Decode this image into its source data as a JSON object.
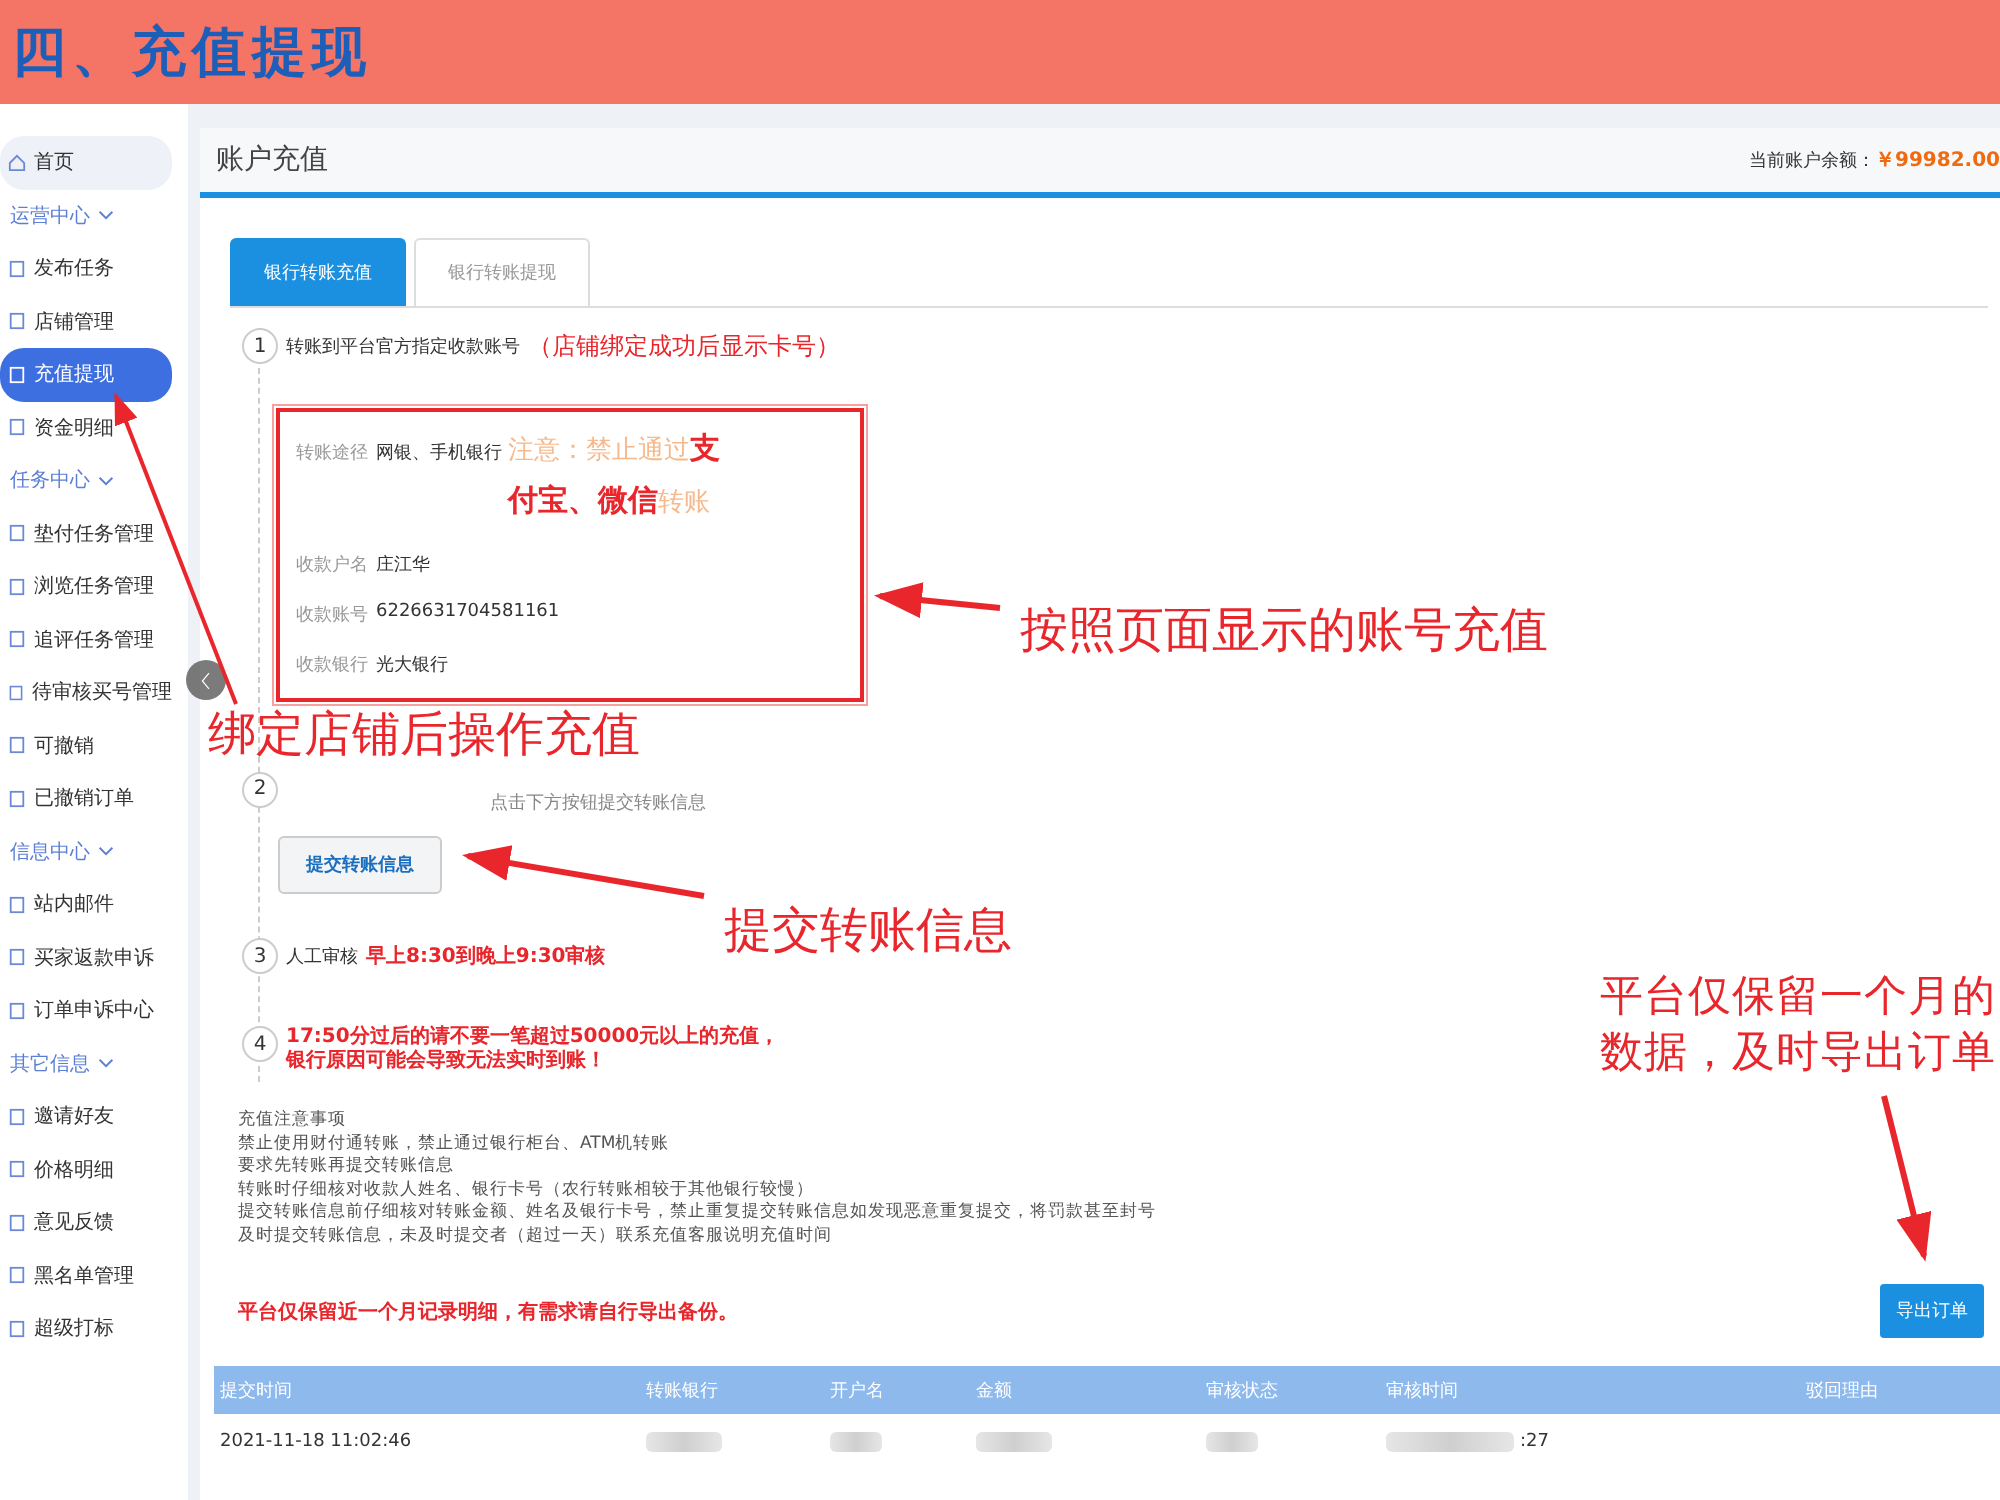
{
  "slide_title": "四、充值提现",
  "sidebar": [
    {
      "kind": "home",
      "label": "首页",
      "selected": false
    },
    {
      "kind": "group",
      "label": "运营中心"
    },
    {
      "kind": "item",
      "label": "发布任务",
      "selected": false
    },
    {
      "kind": "item",
      "label": "店铺管理",
      "selected": false
    },
    {
      "kind": "item",
      "label": "充值提现",
      "selected": true
    },
    {
      "kind": "item",
      "label": "资金明细",
      "selected": false
    },
    {
      "kind": "group",
      "label": "任务中心"
    },
    {
      "kind": "item",
      "label": "垫付任务管理",
      "selected": false
    },
    {
      "kind": "item",
      "label": "浏览任务管理",
      "selected": false
    },
    {
      "kind": "item",
      "label": "追评任务管理",
      "selected": false
    },
    {
      "kind": "item",
      "label": "待审核买号管理",
      "selected": false
    },
    {
      "kind": "item",
      "label": "可撤销",
      "selected": false
    },
    {
      "kind": "item",
      "label": "已撤销订单",
      "selected": false
    },
    {
      "kind": "group",
      "label": "信息中心"
    },
    {
      "kind": "item",
      "label": "站内邮件",
      "selected": false
    },
    {
      "kind": "item",
      "label": "买家返款申诉",
      "selected": false
    },
    {
      "kind": "item",
      "label": "订单申诉中心",
      "selected": false
    },
    {
      "kind": "group",
      "label": "其它信息"
    },
    {
      "kind": "item",
      "label": "邀请好友",
      "selected": false
    },
    {
      "kind": "item",
      "label": "价格明细",
      "selected": false
    },
    {
      "kind": "item",
      "label": "意见反馈",
      "selected": false
    },
    {
      "kind": "item",
      "label": "黑名单管理",
      "selected": false
    },
    {
      "kind": "item",
      "label": "超级打标",
      "selected": false
    }
  ],
  "page_title": "账户充值",
  "balance": {
    "label": "当前账户余额：",
    "value": "￥99982.00"
  },
  "tabs": [
    {
      "label": "银行转账充值",
      "selected": true
    },
    {
      "label": "银行转账提现",
      "selected": false
    }
  ],
  "step1": {
    "number": "1",
    "text": "转账到平台官方指定收款账号",
    "note": "（店铺绑定成功后显示卡号）"
  },
  "account": [
    {
      "label": "转账途径",
      "value": "网银、手机银行",
      "warning": "注意：禁止通过**支付宝、微信**转账"
    },
    {
      "label": "收款户名",
      "value": "庄江华"
    },
    {
      "label": "收款账号",
      "value": "6226631704581161"
    },
    {
      "label": "收款银行",
      "value": "光大银行"
    }
  ],
  "step2": {
    "number": "2",
    "text": "点击下方按钮提交转账信息",
    "button": "提交转账信息"
  },
  "step3": {
    "number": "3",
    "text": "人工审核",
    "highlight": "早上8:30到晚上9:30审核"
  },
  "step4": {
    "number": "4",
    "text": "17:50分过后的请不要一笔超过50000元以上的充值，银行原因可能会导致无法实时到账！"
  },
  "notes": [
    "充值注意事项",
    "禁止使用财付通转账，禁止通过银行柜台、ATM机转账",
    "要求先转账再提交转账信息",
    "转账时仔细核对收款人姓名、银行卡号（农行转账相较于其他银行较慢）",
    "提交转账信息前仔细核对转账金额、姓名及银行卡号，禁止重复提交转账信息如发现恶意重复提交，将罚款甚至封号",
    "及时提交转账信息，未及时提交者（超过一天）联系充值客服说明充值时间"
  ],
  "retention_notice": "平台仅保留近一个月记录明细，有需求请自行导出备份。",
  "export_button": "导出订单",
  "table": {
    "columns": [
      "提交时间",
      "转账银行",
      "开户名",
      "金额",
      "审核状态",
      "审核时间",
      "驳回理由"
    ],
    "rows": [
      {
        "time": "2021-11-18 11:02:46",
        "review_time_tail": ":27"
      }
    ]
  },
  "annotations": [
    "按照页面显示的账号充值",
    "绑定店铺后操作充值",
    "提交转账信息",
    "平台仅保留一个月的数据，及时导出订单"
  ]
}
